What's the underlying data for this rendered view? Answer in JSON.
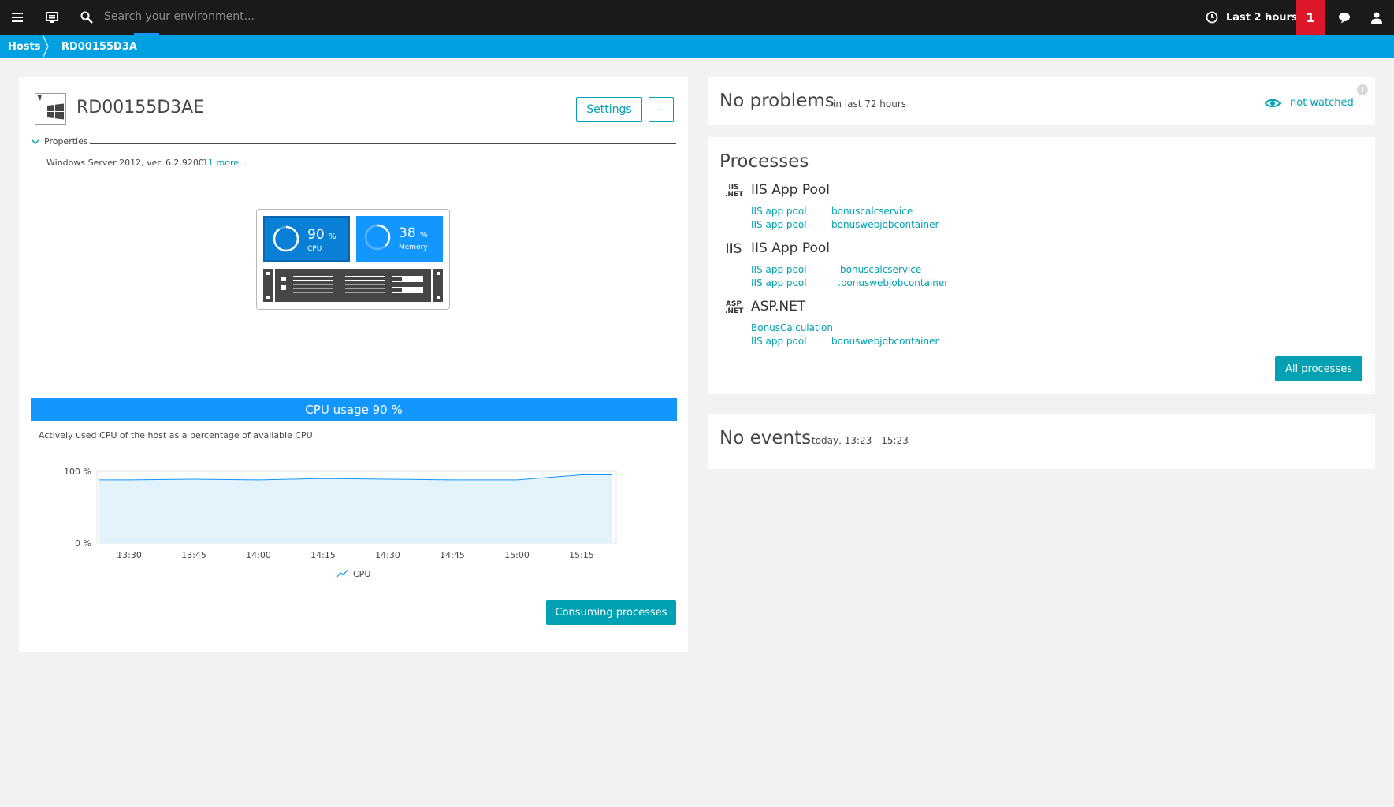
{
  "topbar": {
    "search_placeholder": "Search your environment...",
    "timeframe": "Last 2 hours",
    "problem_count": "1"
  },
  "breadcrumb": [
    "Hosts",
    "RD00155D3A"
  ],
  "host": {
    "name": "RD00155D3AE",
    "settings_label": "Settings",
    "more_label": "···",
    "properties_label": "Properties",
    "os": "Windows Server 2012, ver. 6.2.9200",
    "more_link": "11 more...",
    "cpu": {
      "value": "90",
      "unit": "%",
      "label": "CPU"
    },
    "memory": {
      "value": "38",
      "unit": "%",
      "label": "Memory"
    }
  },
  "cpu_chart": {
    "header": "CPU usage 90 %",
    "description": "Actively used CPU of the host as a percentage of available CPU.",
    "consuming_button": "Consuming processes"
  },
  "chart_data": {
    "type": "area",
    "x": [
      "13:30",
      "13:45",
      "14:00",
      "14:15",
      "14:30",
      "14:45",
      "15:00",
      "15:15"
    ],
    "ytick_labels": [
      "100 %",
      "0 %"
    ],
    "ylim": [
      0,
      100
    ],
    "series": [
      {
        "name": "CPU",
        "values": [
          88,
          89,
          88,
          90,
          89,
          88,
          88,
          95
        ]
      }
    ],
    "legend": "bottom",
    "color": "#1496ff",
    "fill": "#e2f3fb"
  },
  "problems": {
    "title": "No problems",
    "subtitle": "in last 72 hours",
    "watch_label": "not watched"
  },
  "processes": {
    "title": "Processes",
    "groups": [
      {
        "icon": "IIS .NET",
        "name": "IIS App Pool",
        "rows": [
          [
            "IIS app pool",
            "bonuscalcservice"
          ],
          [
            "IIS app pool",
            "bonuswebjobcontainer"
          ]
        ]
      },
      {
        "icon": "IIS",
        "name": "IIS App Pool",
        "rows": [
          [
            "IIS app pool",
            "bonuscalcservice"
          ],
          [
            "IIS app pool",
            ".bonuswebjobcontainer"
          ]
        ]
      },
      {
        "icon": "ASP .NET",
        "name": "ASP.NET",
        "rows": [
          [
            "BonusCalculation",
            ""
          ],
          [
            "IIS app pool",
            "bonuswebjobcontainer"
          ]
        ]
      }
    ],
    "all_button": "All processes"
  },
  "events": {
    "title": "No events",
    "subtitle": "today, 13:23 - 15:23"
  },
  "colors": {
    "accent": "#1496ff",
    "teal": "#00a1b2",
    "alert": "#dc172a"
  }
}
